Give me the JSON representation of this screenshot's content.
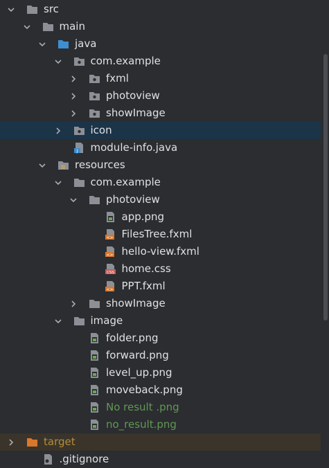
{
  "tree": [
    {
      "name": "src-folder",
      "label": "src",
      "depth": 0,
      "chevron": "down",
      "icon": "folder",
      "color": "default"
    },
    {
      "name": "main-folder",
      "label": "main",
      "depth": 1,
      "chevron": "down",
      "icon": "folder",
      "color": "default"
    },
    {
      "name": "java-folder",
      "label": "java",
      "depth": 2,
      "chevron": "down",
      "icon": "folder-blue",
      "color": "default"
    },
    {
      "name": "com-example-package",
      "label": "com.example",
      "depth": 3,
      "chevron": "down",
      "icon": "package",
      "color": "default"
    },
    {
      "name": "fxml-package",
      "label": "fxml",
      "depth": 4,
      "chevron": "right",
      "icon": "package",
      "color": "default"
    },
    {
      "name": "photoview-package",
      "label": "photoview",
      "depth": 4,
      "chevron": "right",
      "icon": "package",
      "color": "default"
    },
    {
      "name": "showimage-package",
      "label": "showImage",
      "depth": 4,
      "chevron": "right",
      "icon": "package",
      "color": "default"
    },
    {
      "name": "icon-package",
      "label": "icon",
      "depth": 3,
      "chevron": "right",
      "icon": "package",
      "color": "default",
      "selected": true
    },
    {
      "name": "module-info-file",
      "label": "module-info.java",
      "depth": 3,
      "chevron": "none",
      "icon": "java-file",
      "color": "default"
    },
    {
      "name": "resources-folder",
      "label": "resources",
      "depth": 2,
      "chevron": "down",
      "icon": "folder-resources",
      "color": "default"
    },
    {
      "name": "com-example-resources-folder",
      "label": "com.example",
      "depth": 3,
      "chevron": "down",
      "icon": "folder",
      "color": "default"
    },
    {
      "name": "photoview-resources-folder",
      "label": "photoview",
      "depth": 4,
      "chevron": "down",
      "icon": "folder",
      "color": "default"
    },
    {
      "name": "app-png-file",
      "label": "app.png",
      "depth": 5,
      "chevron": "none",
      "icon": "image-file",
      "color": "default"
    },
    {
      "name": "filestree-fxml-file",
      "label": "FilesTree.fxml",
      "depth": 5,
      "chevron": "none",
      "icon": "fxml-file",
      "color": "default"
    },
    {
      "name": "hello-view-fxml-file",
      "label": "hello-view.fxml",
      "depth": 5,
      "chevron": "none",
      "icon": "fxml-file",
      "color": "default"
    },
    {
      "name": "home-css-file",
      "label": "home.css",
      "depth": 5,
      "chevron": "none",
      "icon": "css-file",
      "color": "default"
    },
    {
      "name": "ppt-fxml-file",
      "label": "PPT.fxml",
      "depth": 5,
      "chevron": "none",
      "icon": "fxml-file",
      "color": "default"
    },
    {
      "name": "showimage-resources-folder",
      "label": "showImage",
      "depth": 4,
      "chevron": "right",
      "icon": "folder",
      "color": "default"
    },
    {
      "name": "image-folder",
      "label": "image",
      "depth": 3,
      "chevron": "down",
      "icon": "folder",
      "color": "default"
    },
    {
      "name": "folder-png-file",
      "label": "folder.png",
      "depth": 4,
      "chevron": "none",
      "icon": "image-file",
      "color": "default"
    },
    {
      "name": "forward-png-file",
      "label": "forward.png",
      "depth": 4,
      "chevron": "none",
      "icon": "image-file",
      "color": "default"
    },
    {
      "name": "level-up-png-file",
      "label": "level_up.png",
      "depth": 4,
      "chevron": "none",
      "icon": "image-file",
      "color": "default"
    },
    {
      "name": "moveback-png-file",
      "label": "moveback.png",
      "depth": 4,
      "chevron": "none",
      "icon": "image-file",
      "color": "default"
    },
    {
      "name": "no-result-space-png-file",
      "label": "No result .png",
      "depth": 4,
      "chevron": "none",
      "icon": "image-file",
      "color": "green"
    },
    {
      "name": "no-result-png-file",
      "label": "no_result.png",
      "depth": 4,
      "chevron": "none",
      "icon": "image-file",
      "color": "green"
    },
    {
      "name": "target-folder",
      "label": "target",
      "depth": 0,
      "chevron": "right",
      "icon": "folder-orange",
      "color": "orange",
      "highlight": true
    },
    {
      "name": "gitignore-file",
      "label": ".gitignore",
      "depth": 1,
      "chevron": "none",
      "icon": "gitignore-file",
      "color": "default"
    }
  ],
  "colors": {
    "background": "#2b2d30",
    "selected": "#1c3448",
    "target_row": "#3a342a",
    "text": "#dfe1e5",
    "green_text": "#629755",
    "orange_text": "#b48d3c"
  }
}
